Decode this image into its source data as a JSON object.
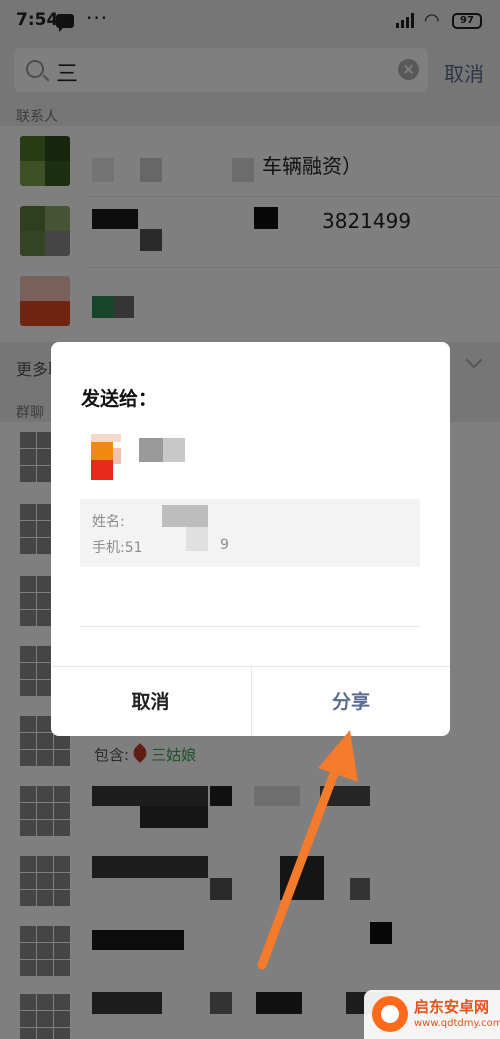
{
  "status_bar": {
    "time": "7:54",
    "more": "···",
    "battery": "97"
  },
  "search": {
    "query": "三",
    "clear": "×",
    "cancel": "取消"
  },
  "sections": {
    "contacts": "联系人",
    "more_contacts": "更多联系人",
    "groups": "群聊"
  },
  "contacts": [
    {
      "visible_text": "车辆融资）"
    },
    {
      "visible_text": "3821499"
    },
    {
      "visible_text": ""
    }
  ],
  "group_chat": {
    "include_label": "包含:",
    "member_name": "三姑娘"
  },
  "dialog": {
    "title": "发送给：",
    "card_name_label": "姓名:",
    "card_phone_label": "手机:51",
    "card_phone_tail": "9",
    "cancel": "取消",
    "share": "分享"
  },
  "watermark": {
    "title": "启东安卓网",
    "url": "www.qdtdmy.com"
  },
  "colors": {
    "accent": "#5b6b91",
    "arrow": "#f47a2c",
    "overlay": "rgba(0,0,0,0.5)"
  }
}
